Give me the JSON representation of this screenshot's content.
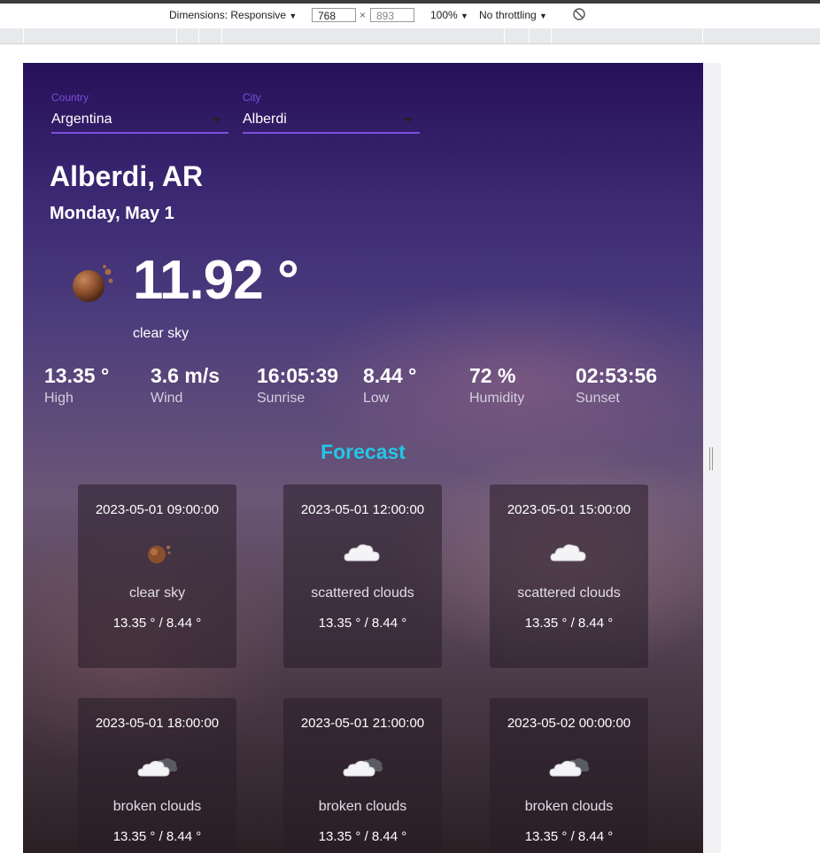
{
  "devtools": {
    "dimensions_label": "Dimensions: Responsive",
    "width": "768",
    "times": "×",
    "height": "893",
    "zoom": "100%",
    "throttling": "No throttling"
  },
  "selectors": {
    "country": {
      "label": "Country",
      "value": "Argentina"
    },
    "city": {
      "label": "City",
      "value": "Alberdi"
    }
  },
  "current": {
    "location": "Alberdi, AR",
    "date": "Monday, May 1",
    "temperature": "11.92 °",
    "description": "clear sky",
    "icon": "clear-sky-icon"
  },
  "stats": [
    {
      "value": "13.35 °",
      "label": "High"
    },
    {
      "value": "3.6 m/s",
      "label": "Wind"
    },
    {
      "value": "16:05:39",
      "label": "Sunrise"
    },
    {
      "value": "8.44 °",
      "label": "Low"
    },
    {
      "value": "72 %",
      "label": "Humidity"
    },
    {
      "value": "02:53:56",
      "label": "Sunset"
    }
  ],
  "forecast": {
    "title": "Forecast",
    "items": [
      {
        "datetime": "2023-05-01 09:00:00",
        "description": "clear sky",
        "temps": "13.35 ° / 8.44 °",
        "icon": "clear-sky-icon"
      },
      {
        "datetime": "2023-05-01 12:00:00",
        "description": "scattered clouds",
        "temps": "13.35 ° / 8.44 °",
        "icon": "cloud-icon"
      },
      {
        "datetime": "2023-05-01 15:00:00",
        "description": "scattered clouds",
        "temps": "13.35 ° / 8.44 °",
        "icon": "cloud-icon"
      },
      {
        "datetime": "2023-05-01 18:00:00",
        "description": "broken clouds",
        "temps": "13.35 ° / 8.44 °",
        "icon": "broken-clouds-icon"
      },
      {
        "datetime": "2023-05-01 21:00:00",
        "description": "broken clouds",
        "temps": "13.35 ° / 8.44 °",
        "icon": "broken-clouds-icon"
      },
      {
        "datetime": "2023-05-02 00:00:00",
        "description": "broken clouds",
        "temps": "13.35 ° / 8.44 °",
        "icon": "broken-clouds-icon"
      }
    ]
  },
  "colors": {
    "accent": "#7c4ddb",
    "forecast_title": "#25c5e6"
  }
}
